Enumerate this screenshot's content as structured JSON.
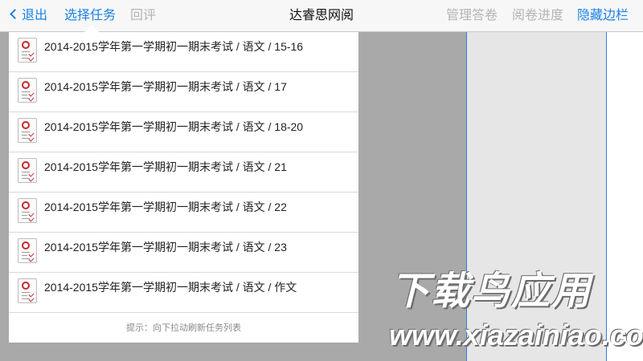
{
  "navbar": {
    "back_label": "退出",
    "select_task_label": "选择任务",
    "review_label": "回评",
    "title": "达睿思网阅",
    "manage_label": "管理答卷",
    "progress_label": "阅卷进度",
    "hide_sidebar_label": "隐藏边栏"
  },
  "task_list": {
    "items": [
      {
        "label": "2014-2015学年第一学期初一期末考试 / 语文 / 15-16"
      },
      {
        "label": "2014-2015学年第一学期初一期末考试 / 语文 / 17"
      },
      {
        "label": "2014-2015学年第一学期初一期末考试 / 语文 / 18-20"
      },
      {
        "label": "2014-2015学年第一学期初一期末考试 / 语文 / 21"
      },
      {
        "label": "2014-2015学年第一学期初一期末考试 / 语文 / 22"
      },
      {
        "label": "2014-2015学年第一学期初一期末考试 / 语文 / 23"
      },
      {
        "label": "2014-2015学年第一学期初一期末考试 / 语文 / 作文"
      }
    ],
    "hint": "提示：向下拉动刷新任务列表"
  },
  "watermark": {
    "logo_text": "下载鸟应用",
    "url": "www.xiazainiao.com"
  },
  "colors": {
    "accent": "#1a82e6",
    "disabled": "#b4b4b4",
    "backdrop": "#a9a9a9"
  }
}
